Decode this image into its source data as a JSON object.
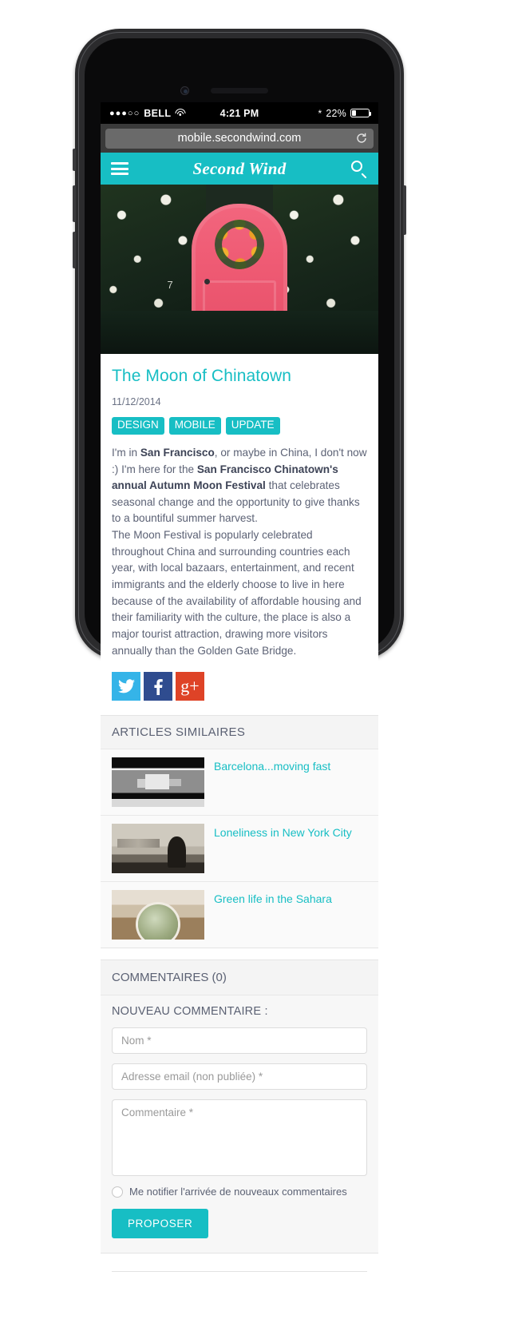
{
  "status_bar": {
    "signal_dots": "●●●○○",
    "carrier": "BELL",
    "wifi_icon": "wifi-icon",
    "time": "4:21 PM",
    "bluetooth_icon": "bluetooth-icon",
    "battery_percent": "22%",
    "battery_icon": "battery-icon"
  },
  "browser": {
    "url": "mobile.secondwind.com",
    "reload_icon": "reload-icon"
  },
  "site_header": {
    "menu_icon": "hamburger-menu-icon",
    "brand": "Second Wind",
    "search_icon": "search-icon"
  },
  "hero": {
    "alt": "pink-door-with-wreath-photo",
    "house_number": "7"
  },
  "article": {
    "title": "The Moon of Chinatown",
    "date": "11/12/2014",
    "tags": [
      "DESIGN",
      "MOBILE",
      "UPDATE"
    ],
    "paragraph_1_part_1": "I'm in ",
    "paragraph_1_bold_1": "San Francisco",
    "paragraph_1_part_2": ", or maybe in China, I don't now :) I'm here for the ",
    "paragraph_1_bold_2": "San Francisco Chinatown's annual Autumn Moon Festival",
    "paragraph_1_part_3": " that celebrates seasonal change and the opportunity to give thanks to a bountiful summer harvest.",
    "paragraph_2": "The Moon Festival is popularly celebrated throughout China and surrounding countries each year, with local bazaars, entertainment, and recent immigrants and the elderly choose to live in here because of the availability of affordable housing and their familiarity with the culture, the place is also a major tourist attraction, drawing more visitors annually than the Golden Gate Bridge."
  },
  "social": [
    {
      "name": "twitter-share-button",
      "icon": "twitter-icon",
      "color": "#35b4e8"
    },
    {
      "name": "facebook-share-button",
      "icon": "facebook-icon",
      "color": "#2f4c8f"
    },
    {
      "name": "google-plus-share-button",
      "icon": "google-plus-icon",
      "label": "g+",
      "color": "#de4327"
    }
  ],
  "related": {
    "heading": "ARTICLES SIMILAIRES",
    "items": [
      {
        "title": "Barcelona...moving fast",
        "thumb": "train-motion-blur-thumbnail"
      },
      {
        "title": "Loneliness in New York City",
        "thumb": "person-sitting-skyline-thumbnail"
      },
      {
        "title": "Green life in the Sahara",
        "thumb": "cactus-in-pot-thumbnail"
      }
    ]
  },
  "comments": {
    "heading": "COMMENTAIRES (0)",
    "form_title": "NOUVEAU COMMENTAIRE :",
    "name_placeholder": "Nom *",
    "email_placeholder": "Adresse email (non publiée) *",
    "comment_placeholder": "Commentaire *",
    "notify_label": "Me notifier l'arrivée de nouveaux commentaires",
    "submit_label": "PROPOSER"
  },
  "colors": {
    "accent": "#17bec4",
    "header_dark": "#3a3a3a",
    "text": "#5c6275"
  }
}
